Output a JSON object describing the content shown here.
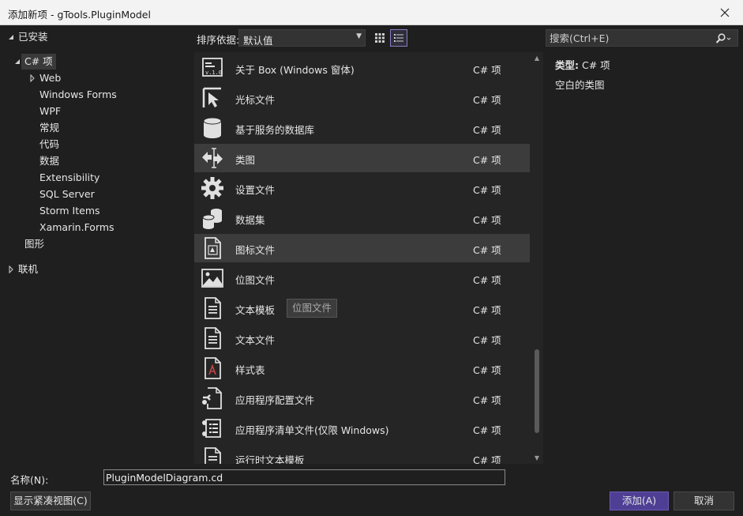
{
  "window": {
    "title": "添加新项 - gTools.PluginModel",
    "close_icon": "close-icon"
  },
  "tree": {
    "installed_label": "已安装",
    "csharp_label": "C# 项",
    "web_label": "Web",
    "children": [
      "Windows Forms",
      "WPF",
      "常规",
      "代码",
      "数据",
      "Extensibility",
      "SQL Server",
      "Storm Items",
      "Xamarin.Forms"
    ],
    "graphics_label": "图形",
    "online_label": "联机"
  },
  "toolbar": {
    "sort_label": "排序依据:",
    "sort_value": "默认值",
    "grid_view_icon": "grid-view-icon",
    "list_view_icon": "list-view-icon"
  },
  "search": {
    "placeholder": "搜索(Ctrl+E)",
    "icon": "search-icon"
  },
  "templates": [
    {
      "name": "关于 Box (Windows 窗体)",
      "type": "C# 项",
      "icon": "about-box-icon"
    },
    {
      "name": "光标文件",
      "type": "C# 项",
      "icon": "cursor-file-icon"
    },
    {
      "name": "基于服务的数据库",
      "type": "C# 项",
      "icon": "database-icon"
    },
    {
      "name": "类图",
      "type": "C# 项",
      "icon": "class-diagram-icon"
    },
    {
      "name": "设置文件",
      "type": "C# 项",
      "icon": "settings-gear-icon"
    },
    {
      "name": "数据集",
      "type": "C# 项",
      "icon": "dataset-icon"
    },
    {
      "name": "图标文件",
      "type": "C# 项",
      "icon": "icon-file-icon"
    },
    {
      "name": "位图文件",
      "type": "C# 项",
      "icon": "bitmap-file-icon"
    },
    {
      "name": "文本模板",
      "type": "C# 项",
      "icon": "text-template-icon"
    },
    {
      "name": "文本文件",
      "type": "C# 项",
      "icon": "text-file-icon"
    },
    {
      "name": "样式表",
      "type": "C# 项",
      "icon": "stylesheet-icon"
    },
    {
      "name": "应用程序配置文件",
      "type": "C# 项",
      "icon": "app-config-icon"
    },
    {
      "name": "应用程序清单文件(仅限 Windows)",
      "type": "C# 项",
      "icon": "app-manifest-icon"
    },
    {
      "name": "运行时文本模板",
      "type": "C# 项",
      "icon": "runtime-text-template-icon"
    }
  ],
  "tooltip": "位图文件",
  "details": {
    "type_label": "类型:",
    "type_value": "C# 项",
    "description": "空白的类图"
  },
  "footer": {
    "name_label": "名称(N):",
    "name_value": "PluginModelDiagram.cd",
    "compact_view_label": "显示紧凑视图(C)",
    "add_label": "添加(A)",
    "cancel_label": "取消"
  },
  "colors": {
    "accent": "#4e3f94",
    "background": "#1f1f1f",
    "highlight": "#3c3c3c"
  }
}
